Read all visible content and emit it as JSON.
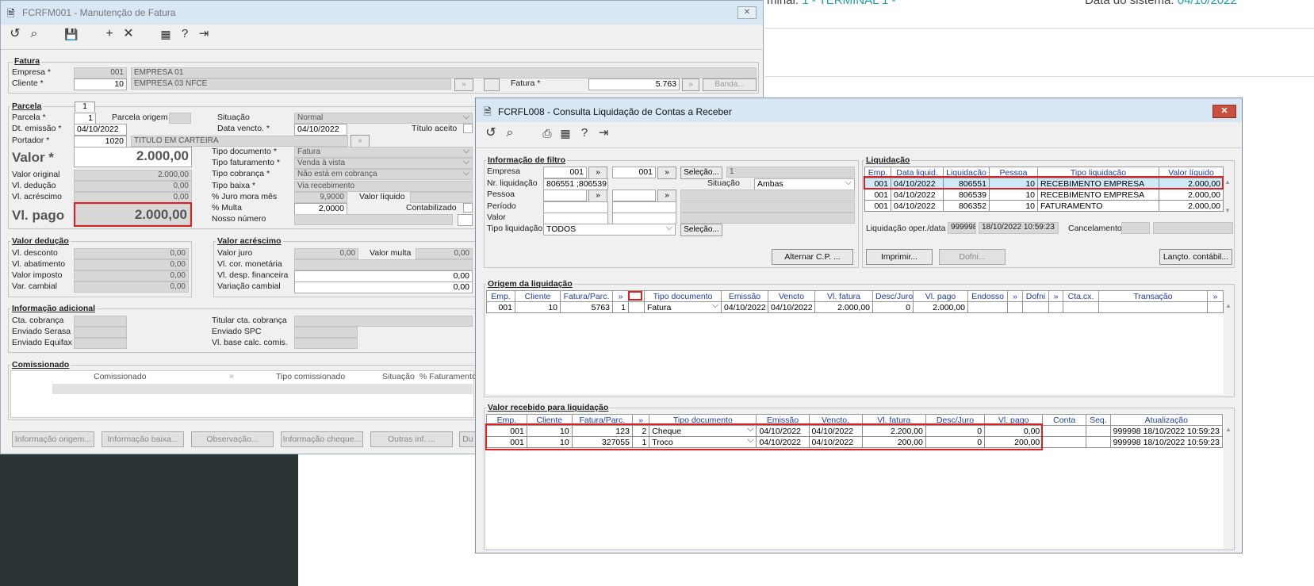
{
  "bg": {
    "terminal_label": "minal:",
    "terminal_value": "1 - TERMINAL 1 -",
    "date_label": "Data do sistema:",
    "date_value": "04/10/2022"
  },
  "w1": {
    "title": "FCRFM001 - Manutenção de Fatura",
    "icons": [
      "undo-icon",
      "search-icon",
      "save-icon",
      "plus-icon",
      "close-icon",
      "calendar-icon",
      "help-icon",
      "exit-icon"
    ],
    "fatura": {
      "header": "Fatura",
      "empresa_label": "Empresa *",
      "empresa_code": "001",
      "empresa_name": "EMPRESA 01",
      "cliente_label": "Cliente *",
      "cliente_code": "10",
      "cliente_name": "EMPRESA 03 NFCE",
      "fatura_label": "Fatura *",
      "fatura_value": "5.763",
      "banda_button": "Banda..."
    },
    "parcela": {
      "header": "Parcela",
      "tab": "1",
      "parcela_label": "Parcela *",
      "parcela_value": "1",
      "origem_label": "Parcela origem",
      "emissao_label": "Dt. emissão *",
      "emissao_value": "04/10/2022",
      "portador_label": "Portador *",
      "portador_code": "1020",
      "portador_name": "TITULO EM CARTEIRA",
      "valor_label": "Valor *",
      "valor_value": "2.000,00",
      "valor_original_label": "Valor original",
      "valor_original_value": "2.000,00",
      "vl_deducao_label": "Vl. dedução",
      "vl_deducao_value": "0,00",
      "vl_acrescimo_label": "Vl. acréscimo",
      "vl_acrescimo_value": "0,00",
      "vl_pago_label": "Vl. pago",
      "vl_pago_value": "2.000,00"
    },
    "situacao": {
      "situacao_label": "Situação",
      "situacao_value": "Normal",
      "vencto_label": "Data vencto. *",
      "vencto_value": "04/10/2022",
      "titulo_aceito_label": "Título aceito",
      "tipo_doc_label": "Tipo documento *",
      "tipo_doc_value": "Fatura",
      "tipo_fat_label": "Tipo faturamento *",
      "tipo_fat_value": "Venda à vista",
      "tipo_cob_label": "Tipo cobrança *",
      "tipo_cob_value": "Não está em cobrança",
      "tipo_baixa_label": "Tipo baixa *",
      "tipo_baixa_value": "Via recebimento",
      "juro_label": "% Juro mora mês",
      "juro_value": "9,9000",
      "vl_liquido_label": "Valor líquido",
      "multa_label": "% Multa",
      "multa_value": "2,0000",
      "contabilizado_label": "Contabilizado",
      "nosso_label": "Nosso número"
    },
    "deducao": {
      "header": "Valor dedução",
      "desconto_label": "Vl. desconto",
      "desconto_value": "0,00",
      "abatimento_label": "Vl. abatimento",
      "abatimento_value": "0,00",
      "imposto_label": "Valor imposto",
      "imposto_value": "0,00",
      "cambial_label": "Var. cambial",
      "cambial_value": "0,00"
    },
    "acrescimo": {
      "header": "Valor acréscimo",
      "juro_label": "Valor juro",
      "juro_value": "0,00",
      "multa_label": "Valor multa",
      "multa_value": "0,00",
      "cor_label": "Vl. cor. monetária",
      "desp_label": "Vl. desp. financeira",
      "desp_value": "0,00",
      "var_label": "Variação cambial",
      "var_value": "0,00"
    },
    "adicional": {
      "header": "Informação adicional",
      "cta_label": "Cta. cobrança",
      "serasa_label": "Enviado Serasa",
      "equifax_label": "Enviado Equifax",
      "titular_label": "Titular cta. cobrança",
      "spc_label": "Enviado SPC",
      "base_label": "Vl. base calc. comis."
    },
    "comissionado": {
      "header": "Comissionado",
      "columns": [
        "Comissionado",
        "Tipo comissionado",
        "Situação",
        "% Faturamento"
      ]
    },
    "buttons": [
      "Informação origem...",
      "Informação baixa...",
      "Observação...",
      "Informação cheque...",
      "Outras inf. ...",
      "Du"
    ]
  },
  "w2": {
    "title": "FCRFL008 - Consulta Liquidação de Contas a Receber",
    "icons": [
      "undo-icon",
      "search-icon",
      "print-icon",
      "calendar-icon",
      "help-icon",
      "exit-icon"
    ],
    "filtro": {
      "header": "Informação de filtro",
      "empresa_label": "Empresa",
      "empresa_from": "001",
      "empresa_to": "001",
      "selecao": "Seleção...",
      "empresa_result": "1",
      "nr_label": "Nr. liquidação",
      "nr_value": "806551 ;806539;",
      "situacao_label": "Situação",
      "situacao_value": "Ambas",
      "pessoa_label": "Pessoa",
      "periodo_label": "Período",
      "valor_label": "Valor",
      "tipo_label": "Tipo liquidação",
      "tipo_value": "TODOS",
      "selecao2": "Seleção...",
      "alternar": "Alternar C.P. ..."
    },
    "liquidacao": {
      "header": "Liquidação",
      "columns": [
        "Emp.",
        "Data liquid.",
        "Liquidação",
        "Pessoa",
        "Tipo liquidação",
        "Valor líquido"
      ],
      "rows": [
        [
          "001",
          "04/10/2022",
          "806551",
          "10",
          "RECEBIMENTO EMPRESA",
          "2.000,00"
        ],
        [
          "001",
          "04/10/2022",
          "806539",
          "10",
          "RECEBIMENTO EMPRESA",
          "2.000,00"
        ],
        [
          "001",
          "04/10/2022",
          "806352",
          "10",
          "FATURAMENTO",
          "2.000,00"
        ]
      ],
      "oper_label": "Liquidação oper./data",
      "oper_code": "999998",
      "oper_date": "18/10/2022 10:59:23",
      "cancel_label": "Cancelamento",
      "imprimir": "Imprimir...",
      "dofni": "Dofni...",
      "lancto": "Lançto. contábil..."
    },
    "origem": {
      "header": "Origem da liquidação",
      "columns": [
        "Emp.",
        "Cliente",
        "Fatura/Parc.",
        "»",
        "",
        "Tipo documento",
        "Emissão",
        "Vencto",
        "Vl. fatura",
        "Desc/Juro",
        "Vl. pago",
        "Endosso",
        "»",
        "Dofni",
        "»",
        "Cta.cx.",
        "Transação",
        "»"
      ],
      "rows": [
        [
          "001",
          "10",
          "5763",
          "1",
          "",
          "Fatura",
          "04/10/2022",
          "04/10/2022",
          "2.000,00",
          "0",
          "2.000,00",
          "",
          "",
          "",
          "",
          "",
          "",
          ""
        ]
      ]
    },
    "recebido": {
      "header": "Valor recebido para liquidação",
      "columns": [
        "Emp.",
        "Cliente",
        "Fatura/Parc.",
        "»",
        "Tipo documento",
        "Emissão",
        "Vencto.",
        "Vl. fatura",
        "Desc/Juro",
        "Vl. pago",
        "Conta",
        "Seq.",
        "Atualização"
      ],
      "rows": [
        [
          "001",
          "10",
          "123",
          "2",
          "Cheque",
          "04/10/2022",
          "04/10/2022",
          "2.200,00",
          "0",
          "0,00",
          "",
          "",
          "999998 18/10/2022 10:59:23"
        ],
        [
          "001",
          "10",
          "327055",
          "1",
          "Troco",
          "04/10/2022",
          "04/10/2022",
          "200,00",
          "0",
          "200,00",
          "",
          "",
          "999998 18/10/2022 10:59:23"
        ]
      ]
    }
  },
  "colors": {
    "title_bg": "#d9e6f4",
    "window_bg": "#f0f0f0",
    "dark_panel": "#2b3535",
    "highlight": "#e02020",
    "header_blue": "#1f41a8"
  }
}
